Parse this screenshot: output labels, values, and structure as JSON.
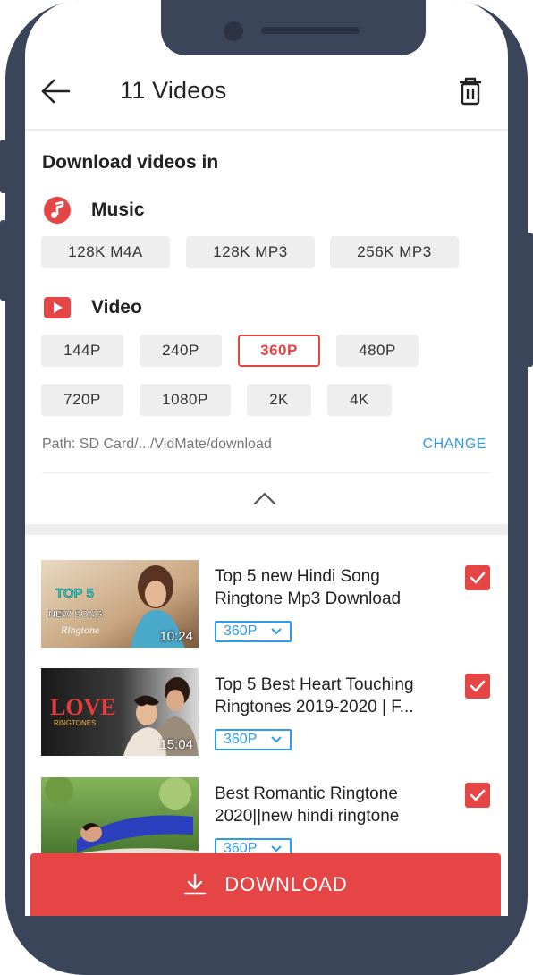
{
  "header": {
    "title": "11 Videos"
  },
  "settings": {
    "heading": "Download videos in",
    "music": {
      "label": "Music",
      "options": [
        "128K  M4A",
        "128K  MP3",
        "256K  MP3"
      ]
    },
    "video": {
      "label": "Video",
      "options": [
        "144P",
        "240P",
        "360P",
        "480P",
        "720P",
        "1080P",
        "2K",
        "4K"
      ],
      "selected": "360P"
    },
    "path": "Path: SD Card/.../VidMate/download",
    "change_label": "CHANGE"
  },
  "videos": [
    {
      "title": "Top 5 new Hindi Song Ringtone Mp3 Download",
      "duration": "10:24",
      "quality": "360P",
      "checked": true,
      "thumb_text": "TOP 5 NEW SONG Ringtone"
    },
    {
      "title": "Top 5 Best Heart Touching Ringtones 2019-2020 | F...",
      "duration": "15:04",
      "quality": "360P",
      "checked": true,
      "thumb_text": "LOVE RINGTONES"
    },
    {
      "title": "Best Romantic Ringtone 2020||new hindi ringtone",
      "duration": "",
      "quality": "360P",
      "checked": true,
      "thumb_text": ""
    }
  ],
  "download_label": "DOWNLOAD",
  "colors": {
    "accent": "#e64545",
    "link": "#2e9ce6",
    "frame": "#3b4559"
  },
  "icons": [
    "back-arrow-icon",
    "trash-icon",
    "music-note-icon",
    "play-video-icon",
    "chevron-up-icon",
    "chevron-down-icon",
    "checkmark-icon",
    "download-icon"
  ]
}
